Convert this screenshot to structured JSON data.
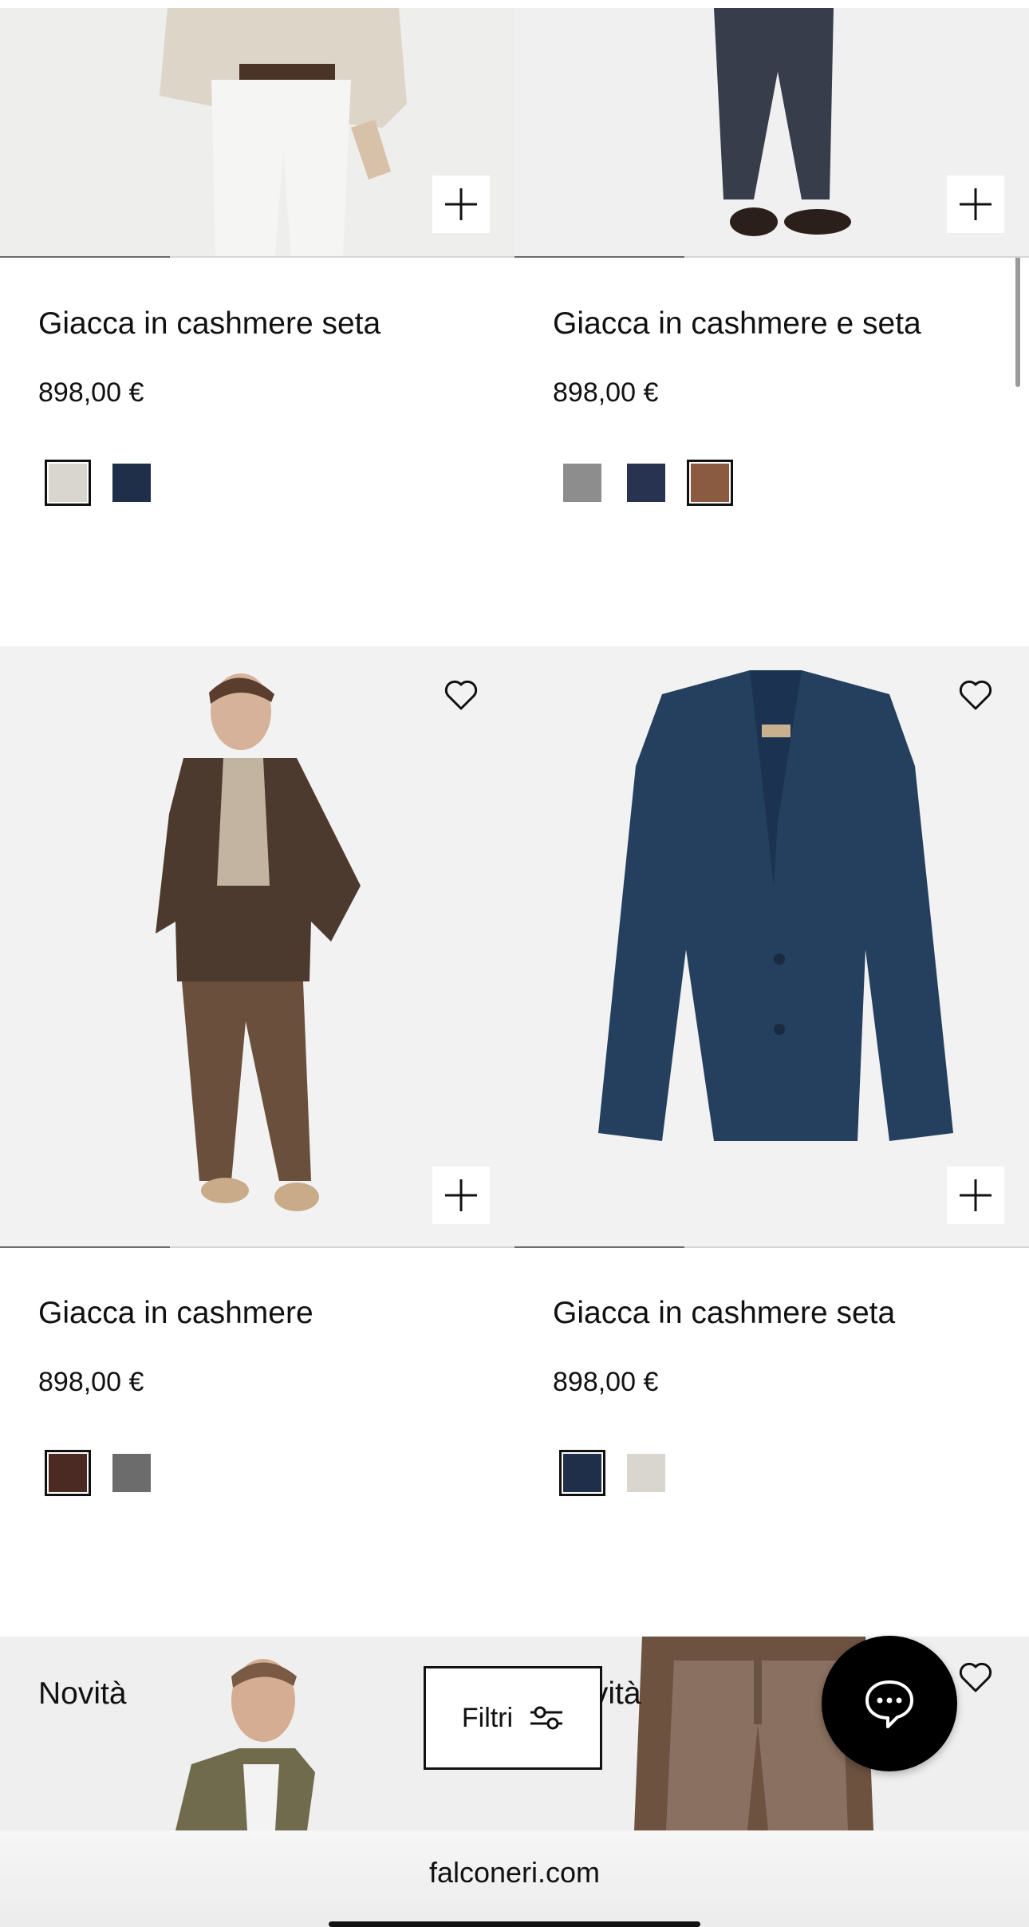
{
  "products": [
    {
      "title": "Giacca in cashmere seta",
      "price": "898,00 €",
      "swatches": [
        "#d9d5cf",
        "#1f2f4a"
      ],
      "selected": 0,
      "image_progress": 0.33
    },
    {
      "title": "Giacca in cashmere e seta",
      "price": "898,00 €",
      "swatches": [
        "#8d8d8d",
        "#283352",
        "#8a5b40"
      ],
      "selected": 2,
      "image_progress": 0.33
    },
    {
      "title": "Giacca in cashmere",
      "price": "898,00 €",
      "swatches": [
        "#4a2a22",
        "#6c6c6c"
      ],
      "selected": 0,
      "image_progress": 0.33
    },
    {
      "title": "Giacca in cashmere seta",
      "price": "898,00 €",
      "swatches": [
        "#1f2f4a",
        "#d9d5cf"
      ],
      "selected": 0,
      "image_progress": 0.33
    }
  ],
  "bottom_row": {
    "left_label": "Novità",
    "right_label": "Novità"
  },
  "filter_button": {
    "label": "Filtri",
    "icon": "sliders-icon"
  },
  "chat_button": {
    "icon": "chat-bubble-icon"
  },
  "browser": {
    "url": "falconeri.com"
  },
  "icons": {
    "add": "plus-icon",
    "wishlist": "heart-icon"
  }
}
